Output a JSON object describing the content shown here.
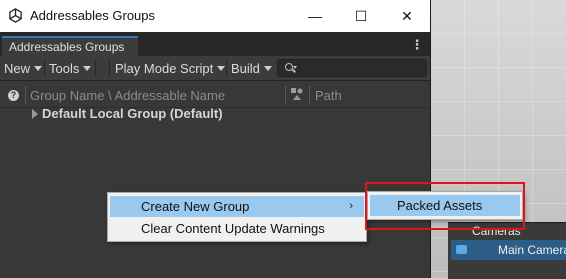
{
  "window": {
    "title": "Addressables Groups",
    "controls": {
      "minimize": "—",
      "maximize": "☐",
      "close": "✕"
    }
  },
  "tab": {
    "label": "Addressables Groups"
  },
  "toolbar": {
    "new_label": "New",
    "tools_label": "Tools",
    "play_mode_label": "Play Mode Script",
    "build_label": "Build",
    "search_placeholder": ""
  },
  "header": {
    "group_name_label": "Group Name \\ Addressable Name",
    "path_label": "Path"
  },
  "tree": {
    "rows": [
      {
        "label": "Default Local Group (Default)"
      }
    ]
  },
  "context_menu": {
    "items": [
      {
        "label": "Create New Group",
        "has_submenu": true,
        "highlighted": true
      },
      {
        "label": "Clear Content Update Warnings",
        "has_submenu": false,
        "highlighted": false
      }
    ],
    "submenu_arrow": "›"
  },
  "submenu": {
    "items": [
      {
        "label": "Packed Assets",
        "highlighted": true
      }
    ]
  },
  "scene": {
    "camera_panel_title": "Cameras",
    "camera_item": "Main Camera"
  },
  "colors": {
    "menu_highlight": "#99c9ef",
    "annotation_box": "#e0151b",
    "tab_accent": "#3a79bb"
  }
}
